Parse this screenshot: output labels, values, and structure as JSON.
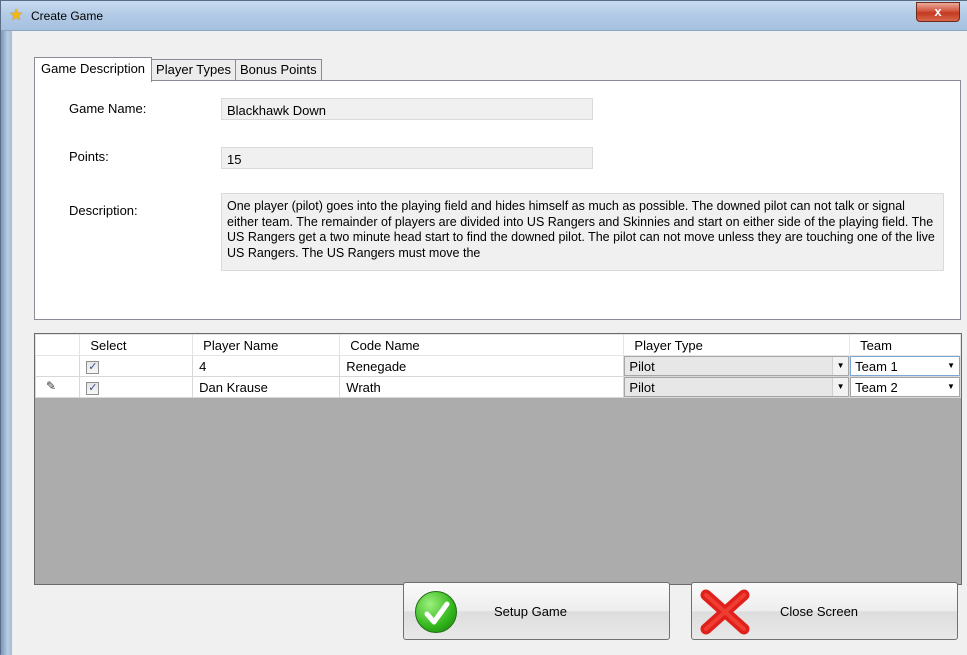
{
  "window": {
    "title": "Create Game",
    "close_glyph": "x"
  },
  "tabs": [
    {
      "label": "Game Description",
      "active": true
    },
    {
      "label": "Player Types",
      "active": false
    },
    {
      "label": "Bonus Points",
      "active": false
    }
  ],
  "form": {
    "game_name_label": "Game Name:",
    "game_name_value": "Blackhawk Down",
    "points_label": "Points:",
    "points_value": "15",
    "description_label": "Description:",
    "description_value": "One player (pilot) goes into the playing field and hides himself as much as possible.  The downed pilot can not talk or signal either team.  The remainder of players are divided into US Rangers and Skinnies and start on either side of the playing field. The US Rangers get a two minute head start to find the downed pilot.  The pilot can not move unless they are touching one of the live US Rangers.  The US Rangers must move the"
  },
  "grid": {
    "columns": [
      "Select",
      "Player Name",
      "Code Name",
      "Player Type",
      "Team"
    ],
    "rows": [
      {
        "selected": true,
        "player_name": "4",
        "code_name": "Renegade",
        "player_type": "Pilot",
        "team": "Team 1",
        "editing": false
      },
      {
        "selected": true,
        "player_name": "Dan Krause",
        "code_name": "Wrath",
        "player_type": "Pilot",
        "team": "Team 2",
        "editing": true
      }
    ]
  },
  "buttons": {
    "setup": {
      "label": "Setup Game",
      "icon": "green-check-icon"
    },
    "close": {
      "label": "Close Screen",
      "icon": "red-x-icon"
    }
  },
  "colors": {
    "accent_green": "#31b51a",
    "accent_red": "#e0201b",
    "grid_background": "#acacac"
  }
}
